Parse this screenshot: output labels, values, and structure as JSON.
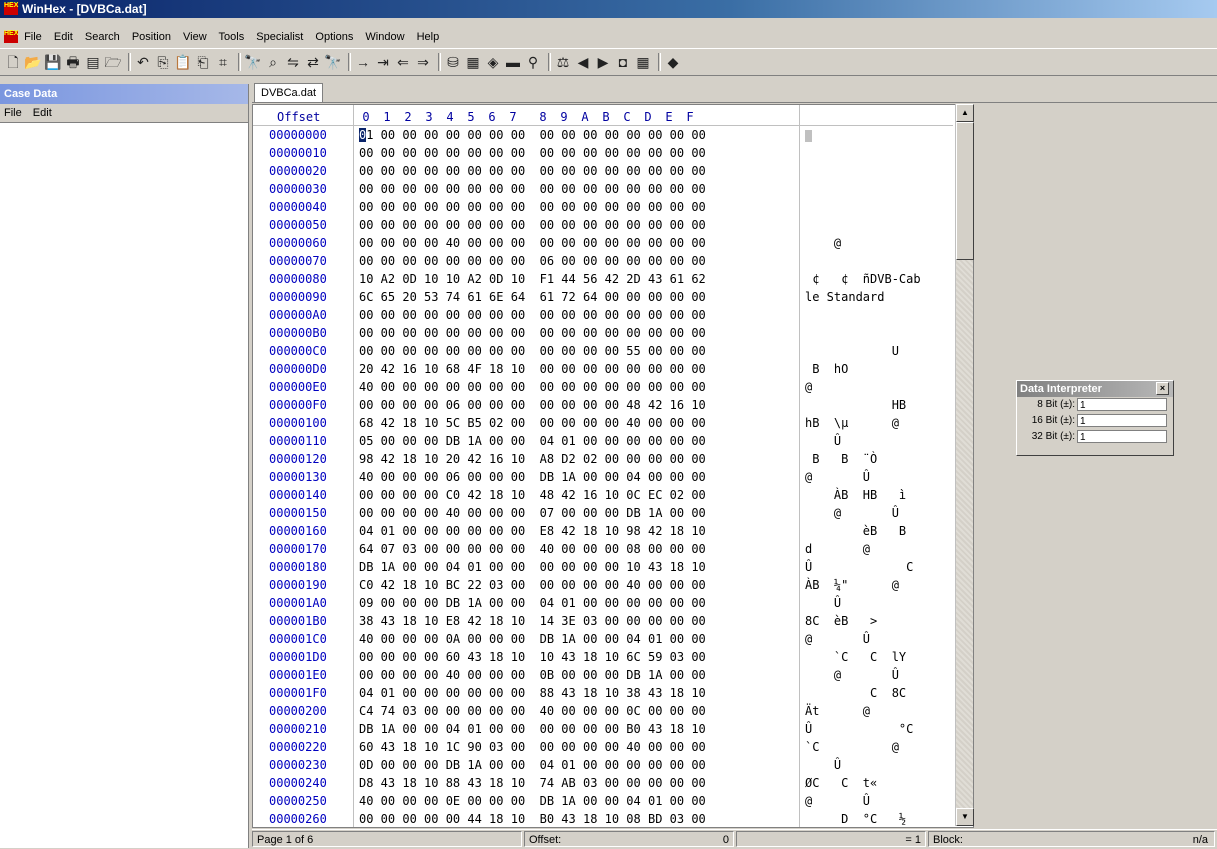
{
  "window": {
    "title": "WinHex - [DVBCa.dat]",
    "app_icon_label": "HEX"
  },
  "menu": [
    "File",
    "Edit",
    "Search",
    "Position",
    "View",
    "Tools",
    "Specialist",
    "Options",
    "Window",
    "Help"
  ],
  "case_panel": {
    "title": "Case Data",
    "menu": [
      "File",
      "Edit"
    ]
  },
  "tab": {
    "label": "DVBCa.dat"
  },
  "editor": {
    "offset_header": "Offset",
    "columns": [
      "0",
      "1",
      "2",
      "3",
      "4",
      "5",
      "6",
      "7",
      "8",
      "9",
      "A",
      "B",
      "C",
      "D",
      "E",
      "F"
    ],
    "rows": [
      {
        "addr": "00000000",
        "hex": "01 00 00 00 00 00 00 00  00 00 00 00 00 00 00 00",
        "text": ""
      },
      {
        "addr": "00000010",
        "hex": "00 00 00 00 00 00 00 00  00 00 00 00 00 00 00 00",
        "text": ""
      },
      {
        "addr": "00000020",
        "hex": "00 00 00 00 00 00 00 00  00 00 00 00 00 00 00 00",
        "text": ""
      },
      {
        "addr": "00000030",
        "hex": "00 00 00 00 00 00 00 00  00 00 00 00 00 00 00 00",
        "text": ""
      },
      {
        "addr": "00000040",
        "hex": "00 00 00 00 00 00 00 00  00 00 00 00 00 00 00 00",
        "text": ""
      },
      {
        "addr": "00000050",
        "hex": "00 00 00 00 00 00 00 00  00 00 00 00 00 00 00 00",
        "text": ""
      },
      {
        "addr": "00000060",
        "hex": "00 00 00 00 40 00 00 00  00 00 00 00 00 00 00 00",
        "text": "    @"
      },
      {
        "addr": "00000070",
        "hex": "00 00 00 00 00 00 00 00  06 00 00 00 00 00 00 00",
        "text": ""
      },
      {
        "addr": "00000080",
        "hex": "10 A2 0D 10 10 A2 0D 10  F1 44 56 42 2D 43 61 62",
        "text": " ¢   ¢  ñDVB-Cab"
      },
      {
        "addr": "00000090",
        "hex": "6C 65 20 53 74 61 6E 64  61 72 64 00 00 00 00 00",
        "text": "le Standard"
      },
      {
        "addr": "000000A0",
        "hex": "00 00 00 00 00 00 00 00  00 00 00 00 00 00 00 00",
        "text": ""
      },
      {
        "addr": "000000B0",
        "hex": "00 00 00 00 00 00 00 00  00 00 00 00 00 00 00 00",
        "text": ""
      },
      {
        "addr": "000000C0",
        "hex": "00 00 00 00 00 00 00 00  00 00 00 00 55 00 00 00",
        "text": "            U"
      },
      {
        "addr": "000000D0",
        "hex": "20 42 16 10 68 4F 18 10  00 00 00 00 00 00 00 00",
        "text": " B  hO"
      },
      {
        "addr": "000000E0",
        "hex": "40 00 00 00 00 00 00 00  00 00 00 00 00 00 00 00",
        "text": "@"
      },
      {
        "addr": "000000F0",
        "hex": "00 00 00 00 06 00 00 00  00 00 00 00 48 42 16 10",
        "text": "            HB"
      },
      {
        "addr": "00000100",
        "hex": "68 42 18 10 5C B5 02 00  00 00 00 00 40 00 00 00",
        "text": "hB  \\µ      @"
      },
      {
        "addr": "00000110",
        "hex": "05 00 00 00 DB 1A 00 00  04 01 00 00 00 00 00 00",
        "text": "    Û"
      },
      {
        "addr": "00000120",
        "hex": "98 42 18 10 20 42 16 10  A8 D2 02 00 00 00 00 00",
        "text": " B   B  ¨Ò"
      },
      {
        "addr": "00000130",
        "hex": "40 00 00 00 06 00 00 00  DB 1A 00 00 04 00 00 00",
        "text": "@       Û"
      },
      {
        "addr": "00000140",
        "hex": "00 00 00 00 C0 42 18 10  48 42 16 10 0C EC 02 00",
        "text": "    ÀB  HB   ì"
      },
      {
        "addr": "00000150",
        "hex": "00 00 00 00 40 00 00 00  07 00 00 00 DB 1A 00 00",
        "text": "    @       Û"
      },
      {
        "addr": "00000160",
        "hex": "04 01 00 00 00 00 00 00  E8 42 18 10 98 42 18 10",
        "text": "        èB   B"
      },
      {
        "addr": "00000170",
        "hex": "64 07 03 00 00 00 00 00  40 00 00 00 08 00 00 00",
        "text": "d       @"
      },
      {
        "addr": "00000180",
        "hex": "DB 1A 00 00 04 01 00 00  00 00 00 00 10 43 18 10",
        "text": "Û             C"
      },
      {
        "addr": "00000190",
        "hex": "C0 42 18 10 BC 22 03 00  00 00 00 00 40 00 00 00",
        "text": "ÀB  ¼\"      @"
      },
      {
        "addr": "000001A0",
        "hex": "09 00 00 00 DB 1A 00 00  04 01 00 00 00 00 00 00",
        "text": "    Û"
      },
      {
        "addr": "000001B0",
        "hex": "38 43 18 10 E8 42 18 10  14 3E 03 00 00 00 00 00",
        "text": "8C  èB   >"
      },
      {
        "addr": "000001C0",
        "hex": "40 00 00 00 0A 00 00 00  DB 1A 00 00 04 01 00 00",
        "text": "@       Û"
      },
      {
        "addr": "000001D0",
        "hex": "00 00 00 00 60 43 18 10  10 43 18 10 6C 59 03 00",
        "text": "    `C   C  lY"
      },
      {
        "addr": "000001E0",
        "hex": "00 00 00 00 40 00 00 00  0B 00 00 00 DB 1A 00 00",
        "text": "    @       Û"
      },
      {
        "addr": "000001F0",
        "hex": "04 01 00 00 00 00 00 00  88 43 18 10 38 43 18 10",
        "text": "         C  8C"
      },
      {
        "addr": "00000200",
        "hex": "C4 74 03 00 00 00 00 00  40 00 00 00 0C 00 00 00",
        "text": "Ät      @"
      },
      {
        "addr": "00000210",
        "hex": "DB 1A 00 00 04 01 00 00  00 00 00 00 B0 43 18 10",
        "text": "Û            °C"
      },
      {
        "addr": "00000220",
        "hex": "60 43 18 10 1C 90 03 00  00 00 00 00 40 00 00 00",
        "text": "`C          @"
      },
      {
        "addr": "00000230",
        "hex": "0D 00 00 00 DB 1A 00 00  04 01 00 00 00 00 00 00",
        "text": "    Û"
      },
      {
        "addr": "00000240",
        "hex": "D8 43 18 10 88 43 18 10  74 AB 03 00 00 00 00 00",
        "text": "ØC   C  t«"
      },
      {
        "addr": "00000250",
        "hex": "40 00 00 00 0E 00 00 00  DB 1A 00 00 04 01 00 00",
        "text": "@       Û"
      },
      {
        "addr": "00000260",
        "hex": "00 00 00 00 00 44 18 10  B0 43 18 10 08 BD 03 00",
        "text": "     D  °C   ½"
      }
    ]
  },
  "status": {
    "page": "Page 1 of 6",
    "offset_label": "Offset:",
    "offset_value": "0",
    "sel_value": "= 1",
    "block_label": "Block:",
    "block_value": "n/a"
  },
  "interpreter": {
    "title": "Data Interpreter",
    "rows": [
      {
        "label": "8 Bit (±):",
        "value": "1"
      },
      {
        "label": "16 Bit (±):",
        "value": "1"
      },
      {
        "label": "32 Bit (±):",
        "value": "1"
      }
    ]
  },
  "toolbar_icons": [
    "new-icon",
    "open-icon",
    "save-icon",
    "print-icon",
    "properties-icon",
    "open-folder-icon",
    "undo-icon",
    "copy-icon",
    "paste-icon",
    "paste-block-icon",
    "copy-hex-icon",
    "find-icon",
    "find-hex-icon",
    "replace-icon",
    "replace-hex-icon",
    "find-next-icon",
    "goto-offset-icon",
    "goto-icon",
    "back-icon",
    "forward-icon",
    "disk-icon",
    "ram-icon",
    "disk-tool-icon",
    "calc-icon",
    "search-icon",
    "compare-icon",
    "prev-icon",
    "next-icon",
    "snapshot-icon",
    "table-icon",
    "help-icon"
  ]
}
